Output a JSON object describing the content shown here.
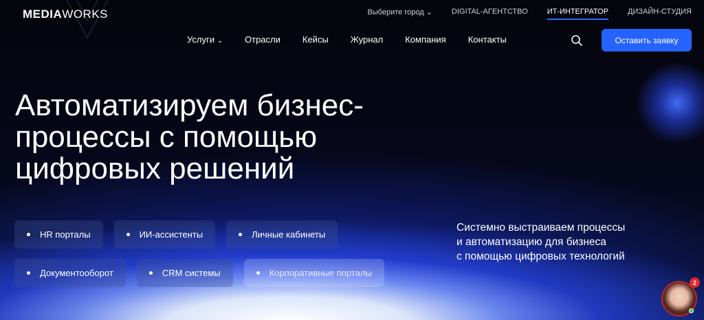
{
  "brand": {
    "logo_bold": "MEDIA",
    "logo_thin": "WORKS"
  },
  "top_links": {
    "city": "Выберите город",
    "digital": "DIGITAL-АГЕНТСТВО",
    "it": "ИТ-ИНТЕГРАТОР",
    "design": "ДИЗАЙН-СТУДИЯ"
  },
  "nav": {
    "services": "Услуги",
    "industries": "Отрасли",
    "cases": "Кейсы",
    "journal": "Журнал",
    "company": "Компания",
    "contacts": "Контакты"
  },
  "cta_label": "Оставить заявку",
  "headline": {
    "line1": "Автоматизируем бизнес-",
    "line2": "процессы с помощью",
    "line3": "цифровых решений"
  },
  "chips_row1": [
    "HR порталы",
    "ИИ-ассистенты",
    "Личные кабинеты"
  ],
  "chips_row2": [
    "Документооборот",
    "CRM системы",
    "Корпоративные порталы"
  ],
  "subtext": {
    "line1": "Системно выстраиваем процессы",
    "line2": "и автоматизацию для бизнеса",
    "line3": "с помощью цифровых технологий"
  },
  "chat": {
    "badge_count": "2"
  },
  "colors": {
    "accent": "#2563ff",
    "background": "#05060d",
    "badge": "#e3262e"
  },
  "icons": [
    "search-icon",
    "chevron-down-icon",
    "chat-avatar"
  ]
}
